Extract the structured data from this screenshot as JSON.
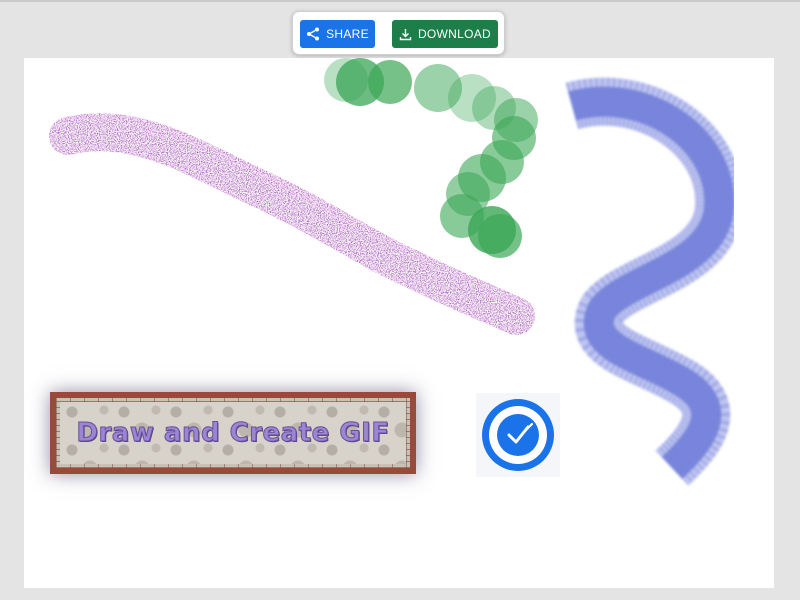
{
  "toolbar": {
    "share_label": "SHARE",
    "download_label": "DOWNLOAD",
    "share_color": "#1a73e8",
    "download_color": "#1e7e4a"
  },
  "canvas": {
    "banner_text": "Draw and Create GIF",
    "strokes": [
      {
        "name": "purple-spray",
        "color": "#9b2fae"
      },
      {
        "name": "green-circles",
        "color": "#3aa655"
      },
      {
        "name": "blue-brush",
        "color": "#4a5bd0"
      }
    ],
    "badge_color": "#1a73e8",
    "badge_icon": "brush-check-icon"
  }
}
